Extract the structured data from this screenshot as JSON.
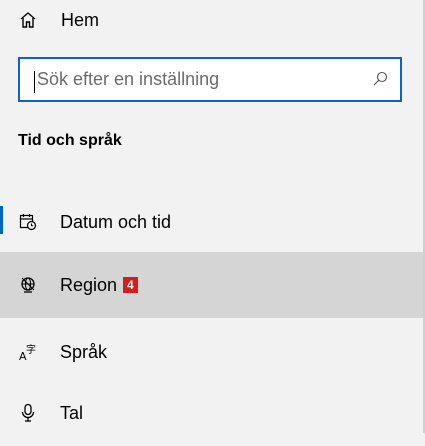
{
  "nav": {
    "home_label": "Hem",
    "home_icon": "home-icon"
  },
  "search": {
    "placeholder": "Sök efter en inställning",
    "icon": "search-icon"
  },
  "section": {
    "title": "Tid och språk"
  },
  "items": [
    {
      "label": "Datum och tid",
      "icon": "calendar-clock-icon",
      "selected_indicator": true
    },
    {
      "label": "Region",
      "icon": "region-globe-icon",
      "badge": "4",
      "hovered": true
    },
    {
      "label": "Språk",
      "icon": "language-icon"
    },
    {
      "label": "Tal",
      "icon": "microphone-icon"
    }
  ],
  "colors": {
    "accent": "#0067c0",
    "search_border": "#0a64c8",
    "badge_bg": "#d11f1f",
    "hover_bg": "#d5d5d5",
    "background": "#f2f2f2"
  }
}
